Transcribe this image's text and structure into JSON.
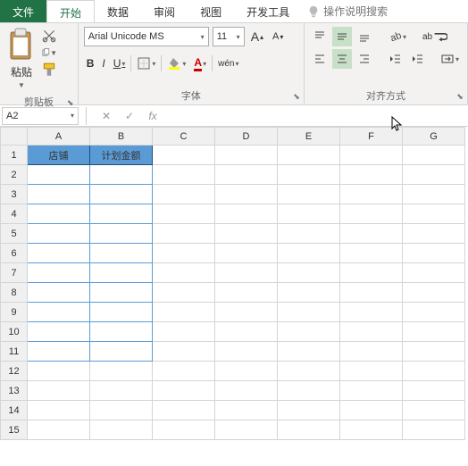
{
  "tabs": {
    "file": "文件",
    "home": "开始",
    "data": "数据",
    "review": "审阅",
    "view": "视图",
    "dev": "开发工具",
    "tell": "操作说明搜索"
  },
  "ribbon": {
    "clipboard": {
      "paste": "粘贴",
      "label": "剪贴板"
    },
    "font": {
      "name": "Arial Unicode MS",
      "size": "11",
      "bold": "B",
      "italic": "I",
      "underline": "U",
      "label": "字体"
    },
    "align": {
      "label": "对齐方式"
    }
  },
  "namebox": "A2",
  "columns": [
    "A",
    "B",
    "C",
    "D",
    "E",
    "F",
    "G"
  ],
  "rows": [
    "1",
    "2",
    "3",
    "4",
    "5",
    "6",
    "7",
    "8",
    "9",
    "10",
    "11",
    "12",
    "13",
    "14",
    "15"
  ],
  "headers": {
    "A1": "店铺",
    "B1": "计划金额"
  },
  "icons": {
    "incA": "A",
    "decA": "A"
  }
}
